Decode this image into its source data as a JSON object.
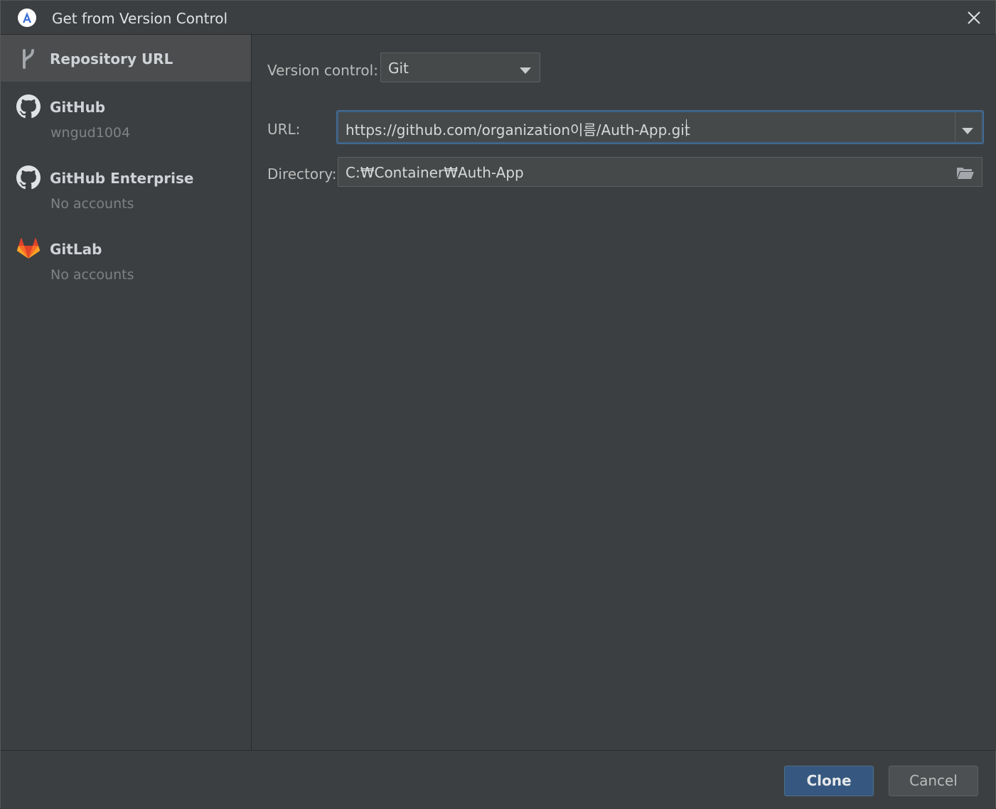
{
  "window": {
    "title": "Get from Version Control",
    "app_icon": "android-studio-icon",
    "close_icon": "close-icon"
  },
  "sidebar": {
    "items": [
      {
        "title": "Repository URL",
        "subtitle": "",
        "icon": "branch-icon",
        "selected": true
      },
      {
        "title": "GitHub",
        "subtitle": "wngud1004",
        "icon": "github-icon",
        "selected": false
      },
      {
        "title": "GitHub Enterprise",
        "subtitle": "No accounts",
        "icon": "github-icon",
        "selected": false
      },
      {
        "title": "GitLab",
        "subtitle": "No accounts",
        "icon": "gitlab-icon",
        "selected": false
      }
    ]
  },
  "form": {
    "version_control_label": "Version control:",
    "version_control_value": "Git",
    "url_label": "URL:",
    "url_value": "https://github.com/organization이름/Auth-App.git",
    "directory_label": "Directory:",
    "directory_value": "C:₩Container₩Auth-App"
  },
  "footer": {
    "clone_label": "Clone",
    "cancel_label": "Cancel"
  },
  "colors": {
    "background": "#3c3f41",
    "selected_item": "#4b4d4f",
    "primary_button": "#365880",
    "focus_border": "#3d6185",
    "gitlab_orange": "#e24329"
  }
}
